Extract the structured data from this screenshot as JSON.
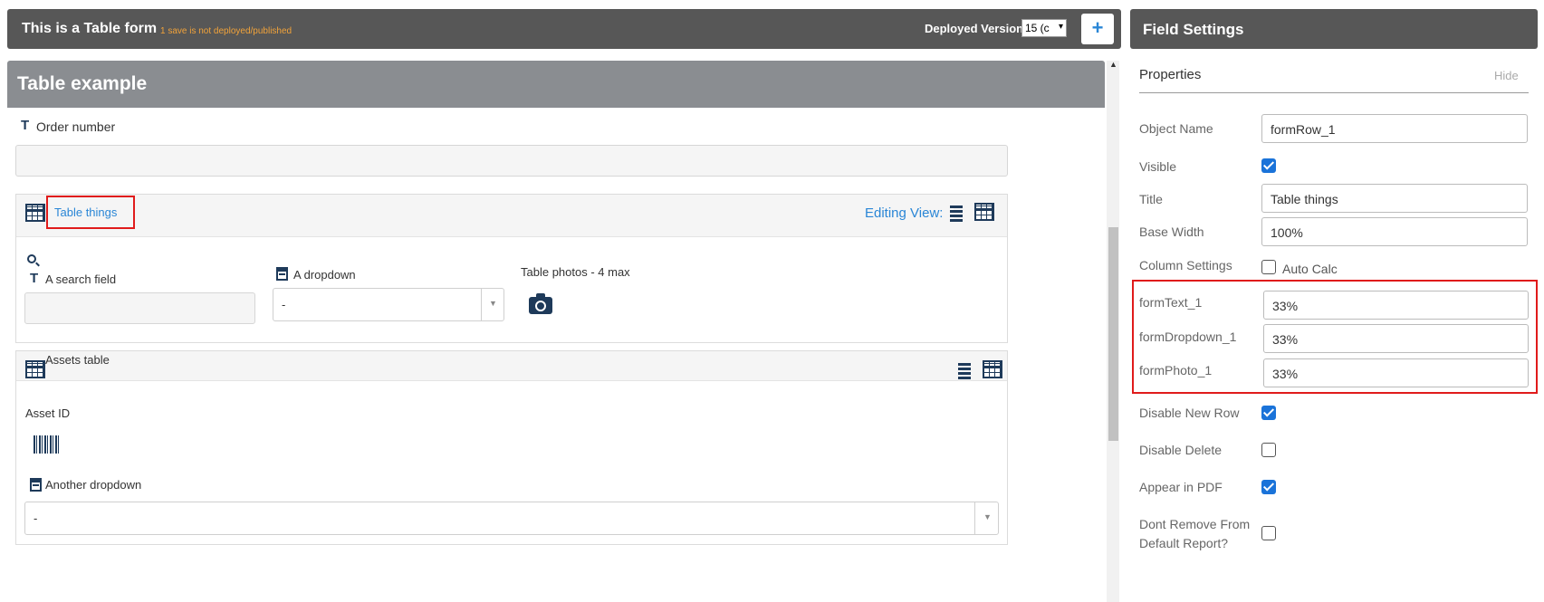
{
  "header": {
    "title": "This is a Table form",
    "unsaved_note": "1 save is not deployed/published",
    "deployed_label": "Deployed Version:",
    "deployed_value": "15 (c",
    "add_label": "+"
  },
  "form": {
    "section_title": "Table example",
    "order_number_label": "Order number",
    "table1": {
      "title": "Table things",
      "editing_view_label": "Editing View:",
      "search_field_label": "A search field",
      "dropdown_label": "A dropdown",
      "dropdown_value": "-",
      "photos_label": "Table photos - 4 max"
    },
    "table2": {
      "title": "Assets table",
      "asset_id_label": "Asset ID",
      "another_dropdown_label": "Another dropdown",
      "another_dropdown_value": "-"
    }
  },
  "settings": {
    "panel_title": "Field Settings",
    "properties_title": "Properties",
    "hide_label": "Hide",
    "object_name_label": "Object Name",
    "object_name_value": "formRow_1",
    "visible_label": "Visible",
    "title_label": "Title",
    "title_value": "Table things",
    "base_width_label": "Base Width",
    "base_width_value": "100%",
    "column_settings_label": "Column Settings",
    "auto_calc_label": "Auto Calc",
    "columns": [
      {
        "name": "formText_1",
        "width": "33%"
      },
      {
        "name": "formDropdown_1",
        "width": "33%"
      },
      {
        "name": "formPhoto_1",
        "width": "33%"
      }
    ],
    "disable_new_row_label": "Disable New Row",
    "disable_delete_label": "Disable Delete",
    "appear_in_pdf_label": "Appear in PDF",
    "dont_remove_label_1": "Dont Remove From",
    "dont_remove_label_2": "Default Report?"
  },
  "colors": {
    "header_bg": "#575757",
    "section_bg": "#8a8d91",
    "accent_blue": "#1a73d9",
    "highlight_red": "#e01b1b",
    "warning_orange": "#f2a33a"
  }
}
